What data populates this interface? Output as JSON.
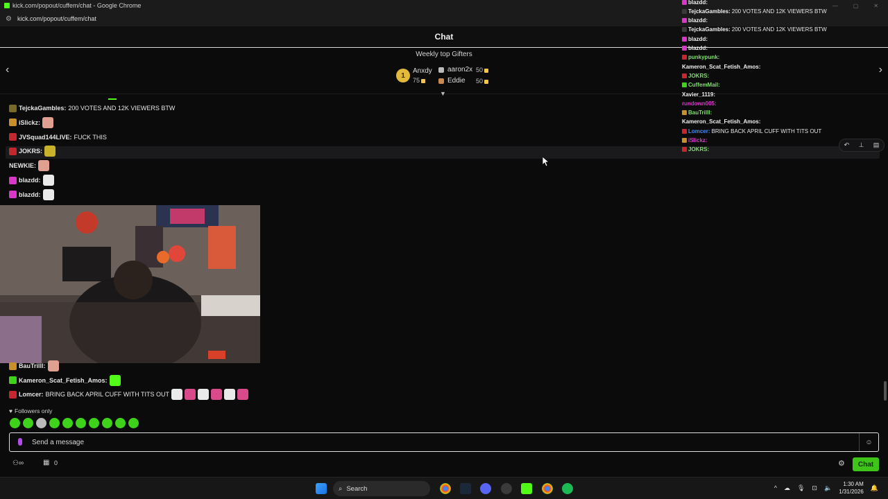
{
  "window": {
    "title": "kick.com/popout/cuffem/chat - Google Chrome",
    "url": "kick.com/popout/cuffem/chat"
  },
  "header": {
    "title": "Chat"
  },
  "gifters": {
    "title": "Weekly top Gifters",
    "first": {
      "rank": "1",
      "name": "Anxdy",
      "count": "75"
    },
    "second": {
      "name": "aaron2x",
      "count": "50"
    },
    "third": {
      "name": "Eddie",
      "count": "50"
    }
  },
  "messages": [
    {
      "user": "TejckaGambles:",
      "text": "200 VOTES AND 12K VIEWERS BTW",
      "badge_color": "#7a6a2a",
      "user_color": "#e6e6e6"
    },
    {
      "user": "iSlickz:",
      "text": "",
      "badge_color": "#c7902b",
      "user_color": "#e6e6e6",
      "emote": "hand-emote"
    },
    {
      "user": "JVSquad144LIVE:",
      "text": "FUCK THIS",
      "badge_color": "#c4282e",
      "user_color": "#e6e6e6"
    },
    {
      "user": "JOKRS:",
      "text": "",
      "badge_color": "#c4282e",
      "user_color": "#e6e6e6",
      "emote": "frog-emote"
    },
    {
      "user": "NEWKIE:",
      "text": "",
      "badge_color": "",
      "user_color": "#e6e6e6",
      "emote": "hand-emote"
    },
    {
      "user": "blazdd:",
      "text": "",
      "badge_color": "#d838c8",
      "user_color": "#e6e6e6",
      "emote": "skull-emote"
    },
    {
      "user": "blazdd:",
      "text": "",
      "badge_color": "#d838c8",
      "user_color": "#e6e6e6",
      "emote": "skull-emote"
    }
  ],
  "messages_lower": [
    {
      "user": "BauTrilll:",
      "text": "",
      "badge_color": "#c7902b",
      "user_color": "#e6e6e6",
      "emote": "hand-emote"
    },
    {
      "user": "Kameron_Scat_Fetish_Amos:",
      "text": "",
      "badge_color": "#3fd21a",
      "user_color": "#e6e6e6",
      "emote": "kick-emote"
    },
    {
      "user": "Lomcer:",
      "text": "BRING BACK APRIL CUFF WITH TITS OUT",
      "badge_color": "#c4282e",
      "user_color": "#e6e6e6",
      "emote": "multi-emote"
    }
  ],
  "overlay_messages": [
    {
      "user": "blazdd:",
      "text": "",
      "badge_color": "#d838c8",
      "user_color": "#f0f0f0"
    },
    {
      "user": "TejckaGambles:",
      "text": "200 VOTES AND 12K VIEWERS BTW",
      "badge_color": "#3a3a3a",
      "user_color": "#f0f0f0"
    },
    {
      "user": "blazdd:",
      "text": "",
      "badge_color": "#d838c8",
      "user_color": "#f0f0f0"
    },
    {
      "user": "TejckaGambles:",
      "text": "200 VOTES AND 12K VIEWERS BTW",
      "badge_color": "#3a3a3a",
      "user_color": "#f0f0f0"
    },
    {
      "user": "blazdd:",
      "text": "",
      "badge_color": "#d838c8",
      "user_color": "#f0f0f0"
    },
    {
      "user": "blazdd:",
      "text": "",
      "badge_color": "#d838c8",
      "user_color": "#f0f0f0"
    },
    {
      "user": "punkypunk:",
      "text": "",
      "badge_color": "#c4282e",
      "user_color": "#7ee06b"
    },
    {
      "user": "Kameron_Scat_Fetish_Amos:",
      "text": "",
      "badge_color": "",
      "user_color": "#f0f0f0"
    },
    {
      "user": "JOKRS:",
      "text": "",
      "badge_color": "#c4282e",
      "user_color": "#7ee06b"
    },
    {
      "user": "CuffemMail:",
      "text": "",
      "badge_color": "#3fd21a",
      "user_color": "#7ee06b"
    },
    {
      "user": "Xavier_1119:",
      "text": "",
      "badge_color": "",
      "user_color": "#f0f0f0"
    },
    {
      "user": "rundown005:",
      "text": "",
      "badge_color": "",
      "user_color": "#d838c8"
    },
    {
      "user": "BauTrilll:",
      "text": "",
      "badge_color": "#c7902b",
      "user_color": "#7ee06b"
    },
    {
      "user": "Kameron_Scat_Fetish_Amos:",
      "text": "",
      "badge_color": "",
      "user_color": "#f0f0f0"
    },
    {
      "user": "Lomcer:",
      "text": "BRING BACK APRIL CUFF WITH TITS OUT",
      "badge_color": "#c4282e",
      "user_color": "#4a8df0"
    },
    {
      "user": "iSlickz:",
      "text": "",
      "badge_color": "#c7902b",
      "user_color": "#d838c8"
    },
    {
      "user": "JOKRS:",
      "text": "",
      "badge_color": "#c4282e",
      "user_color": "#7ee06b"
    }
  ],
  "footer": {
    "followers_only": "Followers only",
    "input_placeholder": "Send a message",
    "count": "0",
    "chat_button": "Chat"
  },
  "taskbar": {
    "search": "Search",
    "time": "1:30 AM",
    "date": "1/31/2026"
  },
  "colors": {
    "accent": "#53fc18",
    "chat_button": "#3fc41a"
  }
}
